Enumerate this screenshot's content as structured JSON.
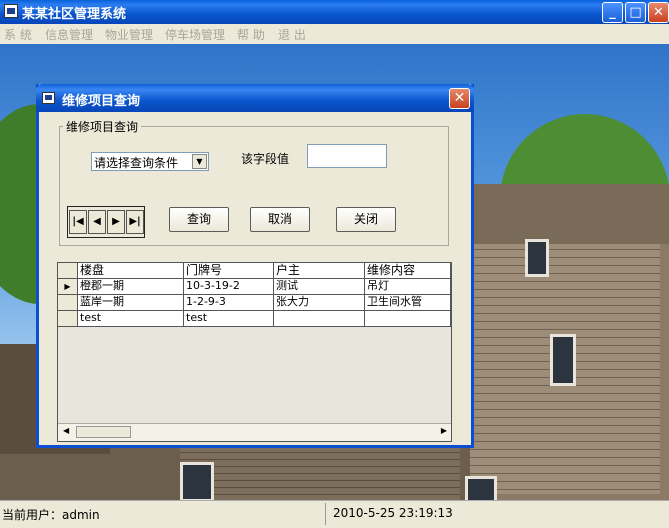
{
  "window": {
    "title": "某某社区管理系统"
  },
  "menu": [
    "系 统",
    "信息管理",
    "物业管理",
    "停车场管理",
    "帮 助",
    "退 出"
  ],
  "dialog": {
    "title": "维修项目查询",
    "group_label": "维修项目查询",
    "combo_value": "请选择查询条件",
    "field_label": "该字段值",
    "field_value": "",
    "buttons": {
      "query": "查询",
      "cancel": "取消",
      "close": "关闭"
    },
    "nav": {
      "first": "first-record-icon",
      "prev": "prev-record-icon",
      "next": "next-record-icon",
      "last": "last-record-icon"
    }
  },
  "grid": {
    "columns": [
      "楼盘",
      "门牌号",
      "户主",
      "维修内容"
    ],
    "rows": [
      [
        "橙郡一期",
        "10-3-19-2",
        "测试",
        "吊灯"
      ],
      [
        "蓝岸一期",
        "1-2-9-3",
        "张大力",
        "卫生间水管"
      ],
      [
        "test",
        "test",
        "",
        ""
      ]
    ],
    "current_row": 0
  },
  "status": {
    "user": "当前用户：admin",
    "datetime": "2010-5-25 23:19:13"
  }
}
